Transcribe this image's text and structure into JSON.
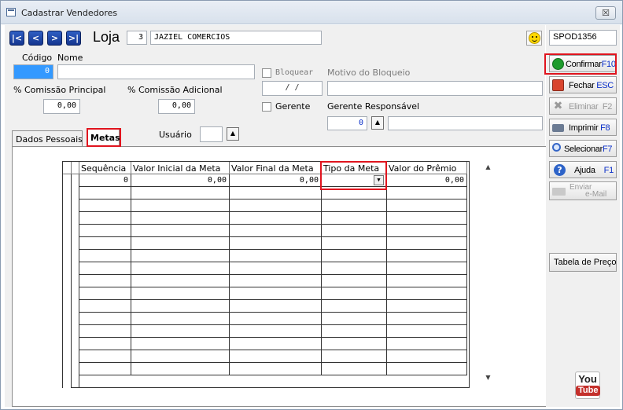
{
  "window": {
    "title": "Cadastrar Vendedores",
    "close_label": "☒"
  },
  "header": {
    "nav_buttons": [
      "|<",
      "<",
      ">",
      ">|"
    ],
    "loja_label": "Loja",
    "loja_code": "3",
    "loja_name": "JAZIEL COMERCIOS",
    "station": "SPOD1356"
  },
  "form": {
    "codigo_label": "Código",
    "nome_label": "Nome",
    "codigo_value": "0",
    "nome_value": "",
    "bloquear_label": "Bloquear",
    "bloquear_date": "/  /",
    "motivo_label": "Motivo do Bloqueio",
    "motivo_value": "",
    "comissao_principal_label": "% Comissão Principal",
    "comissao_principal_value": "0,00",
    "comissao_adicional_label": "% Comissão Adicional",
    "comissao_adicional_value": "0,00",
    "gerente_label": "Gerente",
    "gerente_responsavel_label": "Gerente Responsável",
    "gerente_code": "0",
    "gerente_name": "",
    "usuario_label": "Usuário",
    "usuario_value": ""
  },
  "tabs": [
    {
      "label": "Dados Pessoais",
      "active": false
    },
    {
      "label": "Metas",
      "active": true
    }
  ],
  "grid": {
    "columns": [
      "Sequência",
      "Valor Inicial da Meta",
      "Valor Final da Meta",
      "Tipo da Meta",
      "Valor do Prêmio"
    ],
    "rows": [
      [
        "0",
        "0,00",
        "0,00",
        "",
        "0,00"
      ]
    ],
    "empty_rows": 15
  },
  "sidebar": {
    "confirmar": {
      "label": "Confirmar",
      "key": "F10"
    },
    "fechar": {
      "label": "Fechar",
      "key": "ESC"
    },
    "eliminar": {
      "label": "Eliminar",
      "key": "F2"
    },
    "imprimir": {
      "label": "Imprimir",
      "key": "F8"
    },
    "selecionar": {
      "label": "Selecionar",
      "key": "F7"
    },
    "ajuda": {
      "label": "Ajuda",
      "key": "F1"
    },
    "enviar": {
      "label": "Enviar",
      "label2": "e-Mail"
    },
    "tabela_preco": {
      "label": "Tabela de Preço"
    },
    "youtube": {
      "you": "You",
      "tube": "Tube"
    }
  },
  "colors": {
    "highlight_red": "#e0141e",
    "nav_blue": "#1f4bb0",
    "selected_field": "#3399ff"
  }
}
